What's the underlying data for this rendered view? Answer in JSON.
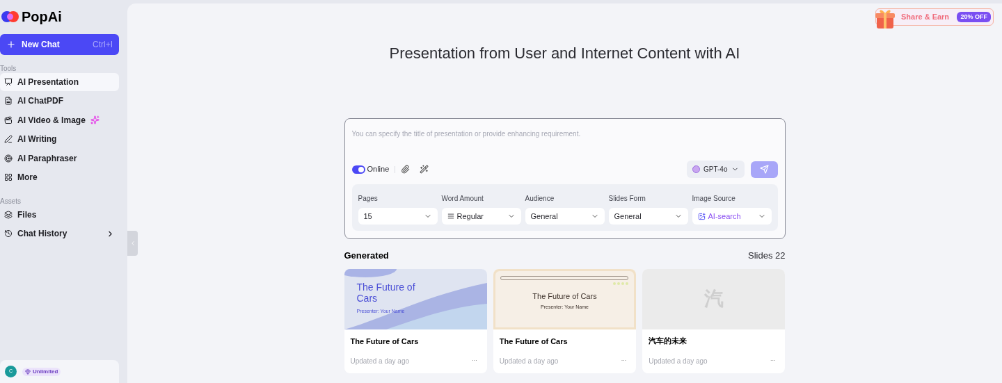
{
  "logo": {
    "name": "PopAi"
  },
  "new_chat": {
    "label": "New Chat",
    "shortcut": "Ctrl+I"
  },
  "sidebar": {
    "sections": [
      {
        "title": "Tools",
        "items": [
          {
            "kind": "presentation",
            "label": "AI Presentation",
            "selected": true
          },
          {
            "kind": "pdf",
            "label": "AI ChatPDF",
            "selected": false
          },
          {
            "kind": "video",
            "label": "AI Video & Image",
            "selected": false,
            "sparkle": true
          },
          {
            "kind": "writing",
            "label": "AI Writing",
            "selected": false
          },
          {
            "kind": "paraphraser",
            "label": "AI Paraphraser",
            "selected": false
          },
          {
            "kind": "more",
            "label": "More",
            "selected": false
          }
        ]
      },
      {
        "title": "Assets",
        "items": [
          {
            "kind": "files",
            "label": "Files",
            "selected": false
          },
          {
            "kind": "history",
            "label": "Chat History",
            "selected": false,
            "submenu": true
          }
        ]
      }
    ],
    "user": {
      "avatar": "C",
      "plan": "Unlimited"
    }
  },
  "promo": {
    "label": "Share & Earn",
    "badge": "20% OFF"
  },
  "title": "Presentation from User and Internet Content with AI",
  "composer": {
    "placeholder": "You can specify the title of presentation or provide enhancing requirement.",
    "online": {
      "label": "Online",
      "on": true
    },
    "model": "GPT-4o"
  },
  "settings": [
    {
      "label": "Pages",
      "value": "15",
      "kind": "plain"
    },
    {
      "label": "Word Amount",
      "value": "Regular",
      "kind": "lines"
    },
    {
      "label": "Audience",
      "value": "General",
      "kind": "plain"
    },
    {
      "label": "Slides Form",
      "value": "General",
      "kind": "plain"
    },
    {
      "label": "Image Source",
      "value": "AI-search",
      "kind": "image"
    }
  ],
  "generated": {
    "title": "Generated",
    "count": "Slides 22",
    "items": [
      {
        "kind": "wave",
        "thumb_title": "The Future of Cars",
        "thumb_subtitle": "Presenter: Your Name",
        "title": "The Future of Cars",
        "updated": "Updated a day ago",
        "menu": "..."
      },
      {
        "kind": "paper",
        "thumb_title": "The Future of Cars",
        "thumb_subtitle": "Presenter: Your Name",
        "title": "The Future of Cars",
        "updated": "Updated a day ago",
        "menu": "..."
      },
      {
        "kind": "blank",
        "thumb_title": "汽",
        "title": "汽车的未来",
        "updated": "Updated a day ago",
        "menu": "..."
      }
    ]
  }
}
